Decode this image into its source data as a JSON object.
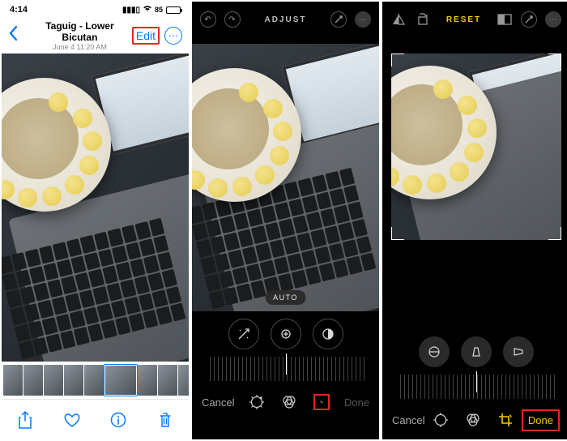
{
  "status": {
    "time": "4:14",
    "battery": "85"
  },
  "screen1": {
    "title": "Taguig - Lower Bicutan",
    "subtitle": "June 4  11:20 AM",
    "edit": "Edit",
    "toolbar": {
      "share": "share",
      "heart": "heart",
      "info": "info",
      "trash": "trash"
    }
  },
  "screen2": {
    "top_label": "ADJUST",
    "auto_pill": "AUTO",
    "cancel": "Cancel",
    "done": "Done"
  },
  "screen3": {
    "reset": "RESET",
    "cancel": "Cancel",
    "done": "Done"
  }
}
